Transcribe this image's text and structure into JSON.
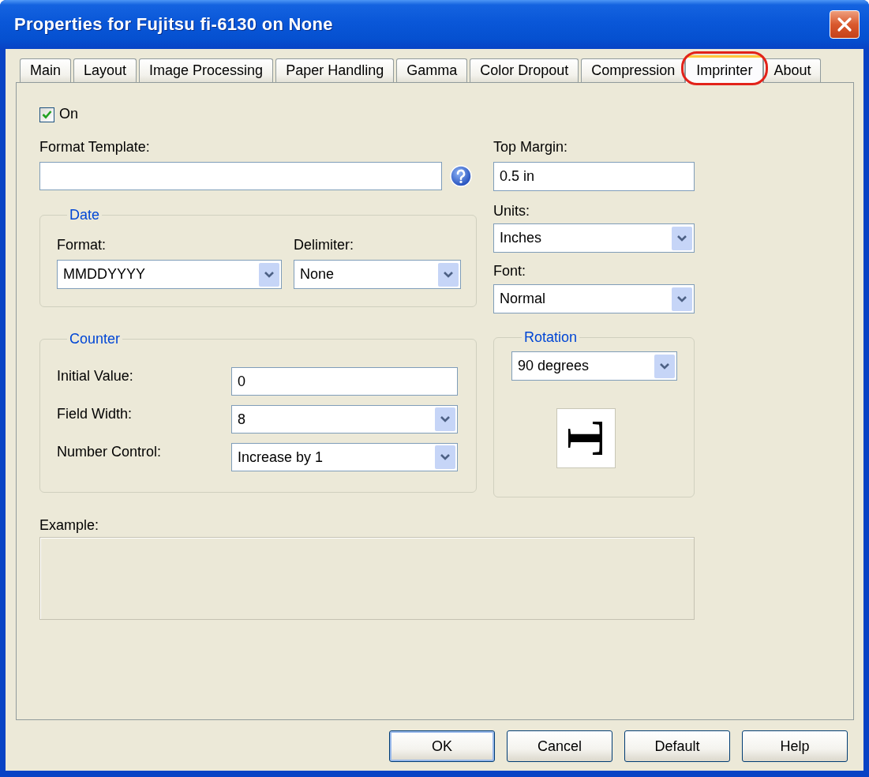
{
  "window": {
    "title": "Properties for Fujitsu fi-6130 on None"
  },
  "tabs": [
    {
      "label": "Main",
      "selected": false,
      "highlighted": false
    },
    {
      "label": "Layout",
      "selected": false,
      "highlighted": false
    },
    {
      "label": "Image Processing",
      "selected": false,
      "highlighted": false
    },
    {
      "label": "Paper Handling",
      "selected": false,
      "highlighted": false
    },
    {
      "label": "Gamma",
      "selected": false,
      "highlighted": false
    },
    {
      "label": "Color Dropout",
      "selected": false,
      "highlighted": false
    },
    {
      "label": "Compression",
      "selected": false,
      "highlighted": false
    },
    {
      "label": "Imprinter",
      "selected": true,
      "highlighted": true
    },
    {
      "label": "About",
      "selected": false,
      "highlighted": false
    }
  ],
  "on": {
    "label": "On",
    "checked": true
  },
  "format_template": {
    "label": "Format Template:"
  },
  "date": {
    "title": "Date",
    "format": {
      "label": "Format:",
      "value": "MMDDYYYY"
    },
    "delimiter": {
      "label": "Delimiter:",
      "value": "None"
    }
  },
  "counter": {
    "title": "Counter",
    "fields": [
      {
        "kind": "text",
        "label": "Initial Value:",
        "value": "0"
      },
      {
        "kind": "dropdown",
        "label": "Field Width:",
        "value": "8"
      },
      {
        "kind": "dropdown",
        "label": "Number Control:",
        "value": "Increase by 1"
      }
    ]
  },
  "top_margin": {
    "label": "Top Margin:",
    "value": "0.5 in"
  },
  "units": {
    "label": "Units:",
    "value": "Inches"
  },
  "font": {
    "label": "Font:",
    "value": "Normal"
  },
  "rotation": {
    "title": "Rotation",
    "value": "90 degrees",
    "preview": "T"
  },
  "example": {
    "label": "Example:"
  },
  "buttons": [
    {
      "label": "OK",
      "default": true
    },
    {
      "label": "Cancel",
      "default": false
    },
    {
      "label": "Default",
      "default": false
    },
    {
      "label": "Help",
      "default": false
    }
  ]
}
